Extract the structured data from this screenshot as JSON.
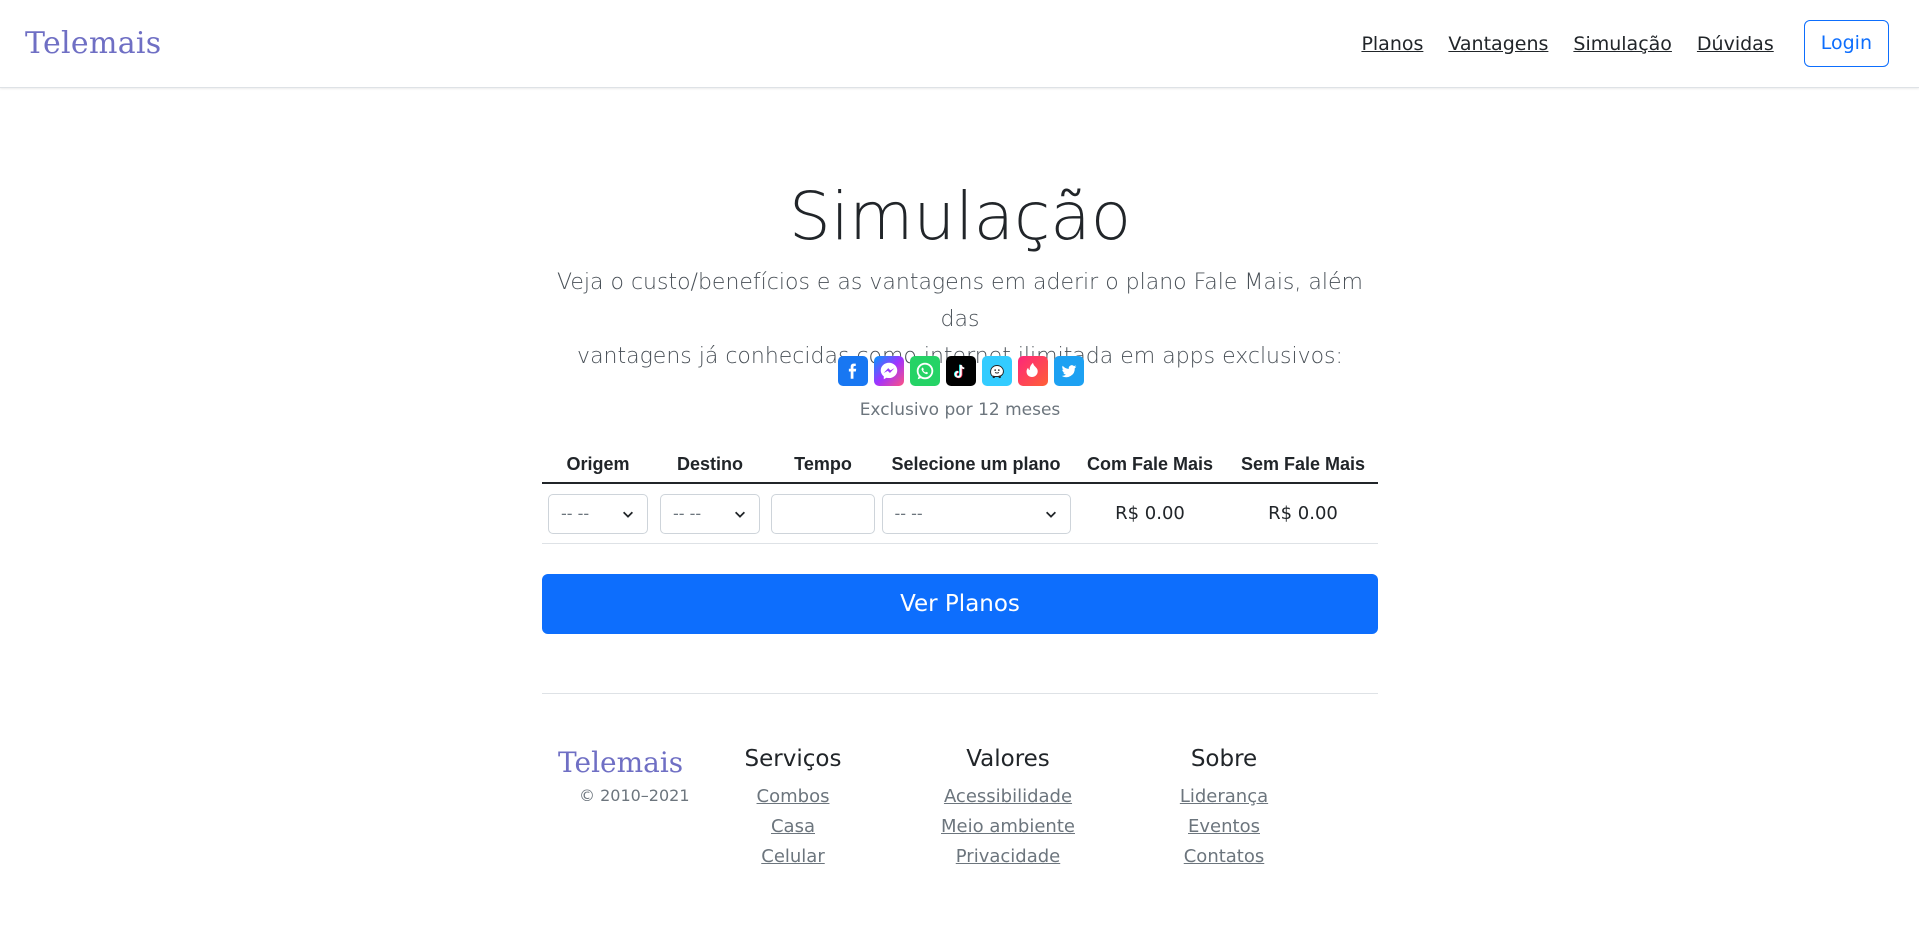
{
  "header": {
    "brand": "Telemais",
    "nav": [
      "Planos",
      "Vantagens",
      "Simulação",
      "Dúvidas"
    ],
    "login": "Login"
  },
  "hero": {
    "title": "Simulação",
    "lead_line1": "Veja o custo/benefícios e as vantagens em aderir o plano Fale Mais, além das",
    "lead_line2": "vantagens já conhecidas como internet ilimitada em apps exclusivos:",
    "apps": [
      "facebook-icon",
      "messenger-icon",
      "whatsapp-icon",
      "tiktok-icon",
      "waze-icon",
      "tinder-icon",
      "twitter-icon"
    ],
    "exclusive": "Exclusivo por 12 meses"
  },
  "table": {
    "headers": [
      "Origem",
      "Destino",
      "Tempo",
      "Selecione um plano",
      "Com Fale Mais",
      "Sem Fale Mais"
    ],
    "origem_value": "-- --",
    "destino_value": "-- --",
    "tempo_value": "",
    "plano_value": "-- --",
    "com_fale_mais": "R$ 0.00",
    "sem_fale_mais": "R$ 0.00"
  },
  "cta": "Ver Planos",
  "footer": {
    "brand": "Telemais",
    "copyright": "© 2010–2021",
    "columns": [
      {
        "title": "Serviços",
        "links": [
          "Combos",
          "Casa",
          "Celular"
        ]
      },
      {
        "title": "Valores",
        "links": [
          "Acessibilidade",
          "Meio ambiente",
          "Privacidade"
        ]
      },
      {
        "title": "Sobre",
        "links": [
          "Liderança",
          "Eventos",
          "Contatos"
        ]
      }
    ]
  },
  "colors": {
    "primary": "#0d6efd",
    "brand": "#6f6fc4"
  }
}
